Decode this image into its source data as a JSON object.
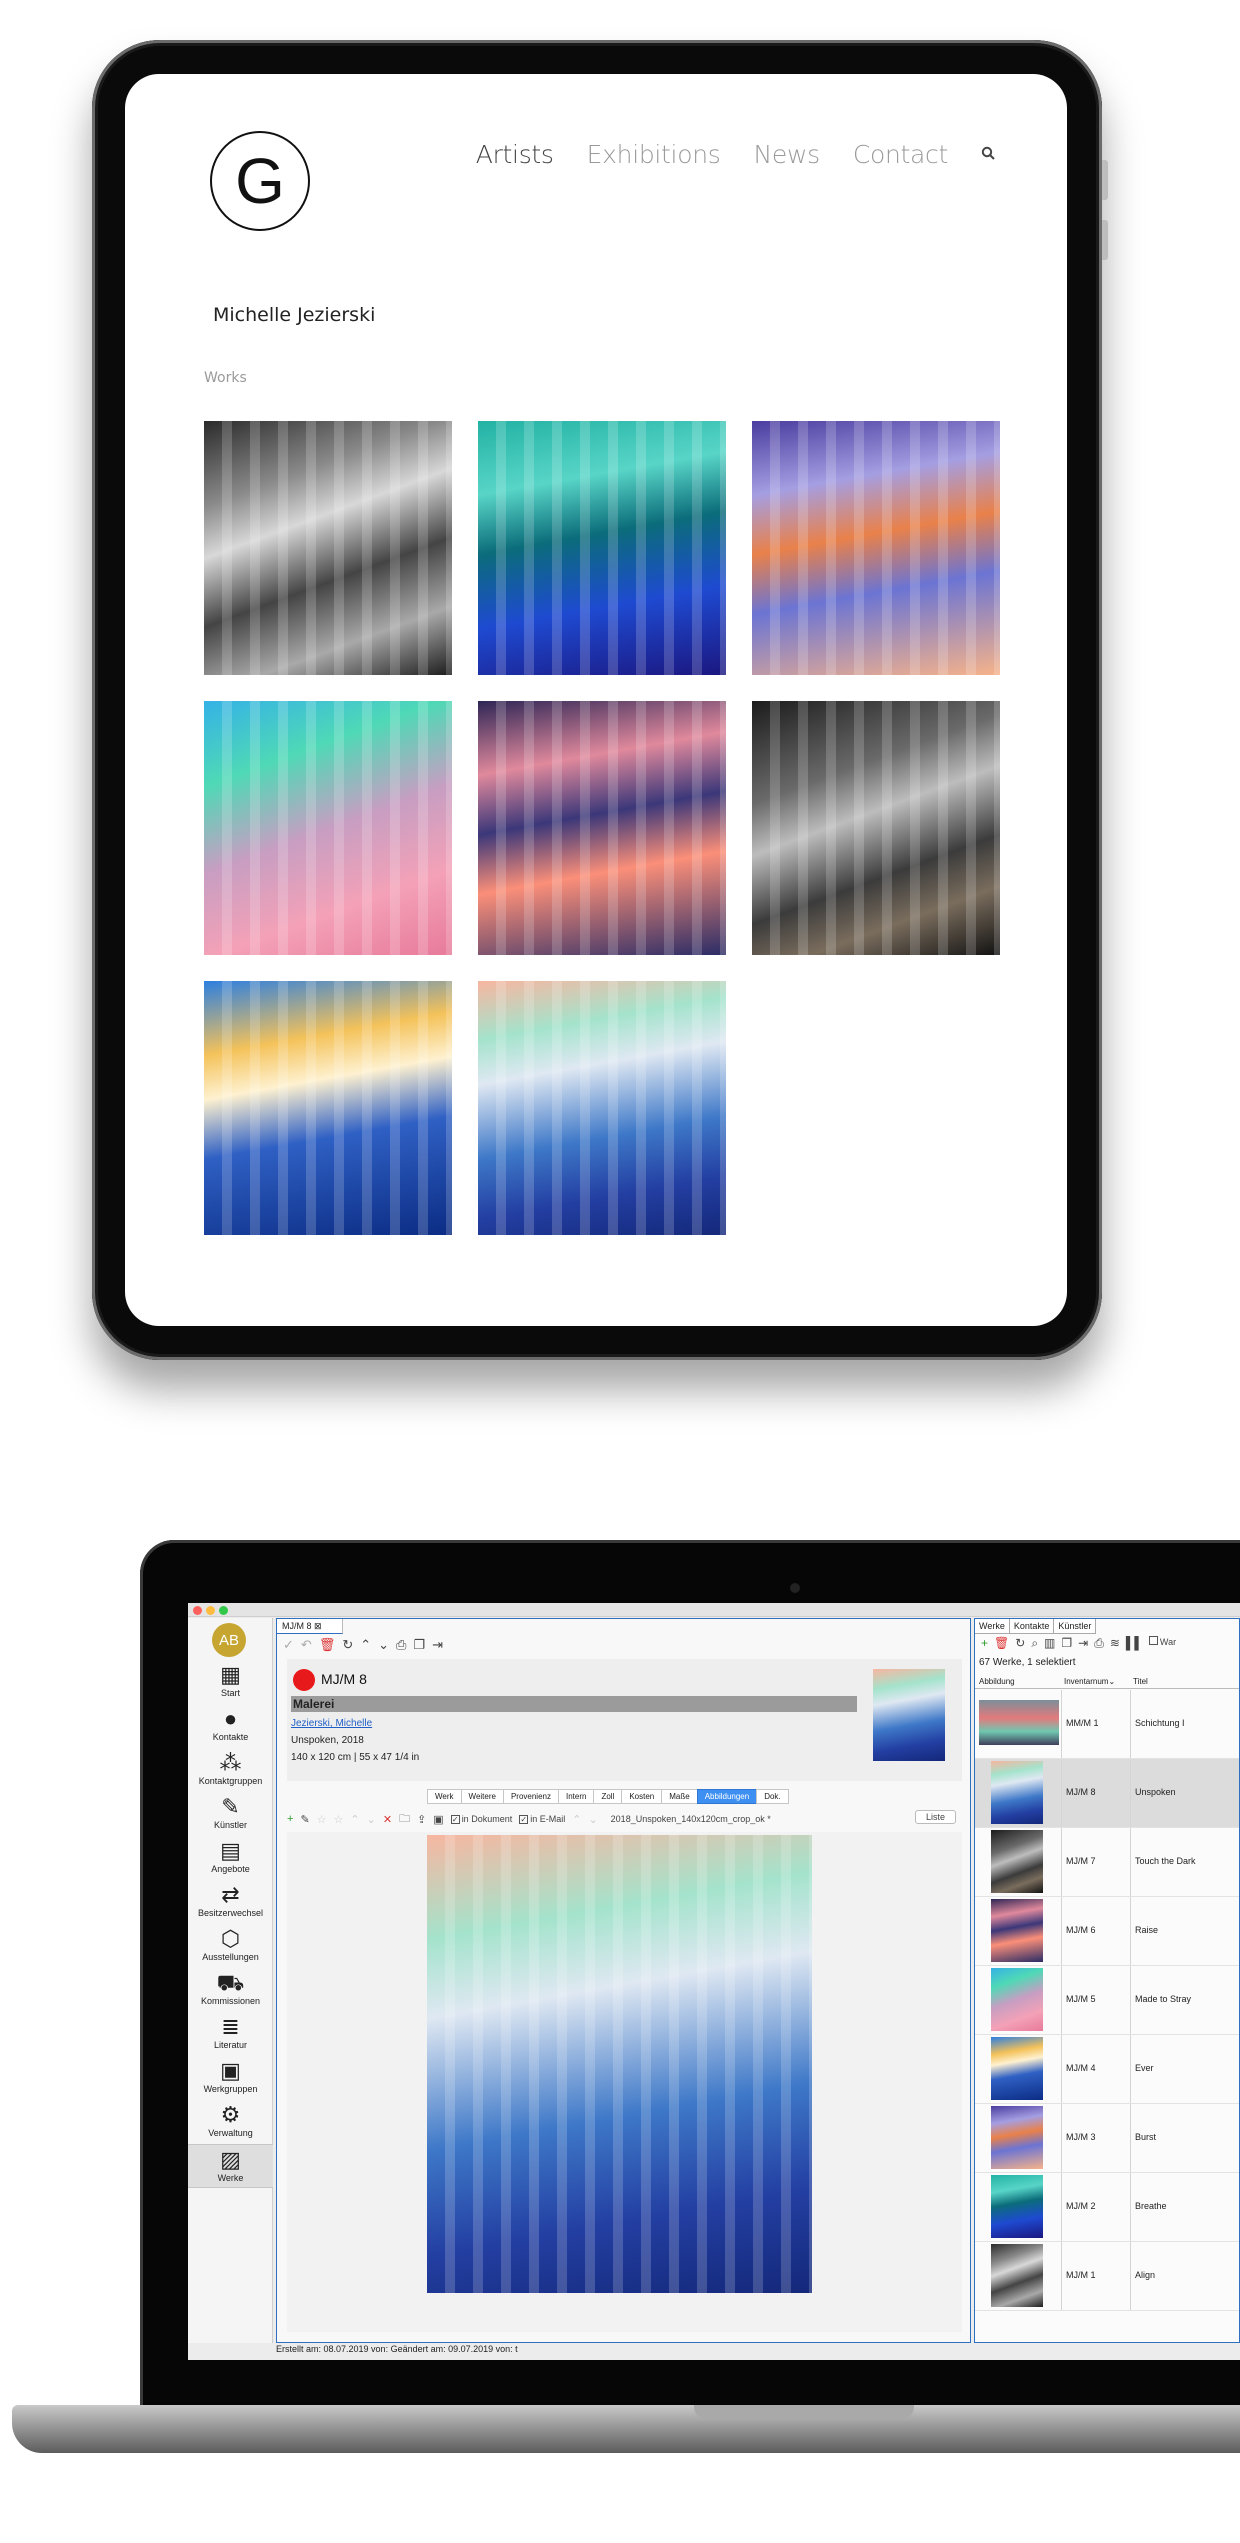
{
  "website": {
    "logo_letter": "G",
    "nav": [
      {
        "label": "Artists",
        "active": true
      },
      {
        "label": "Exhibitions",
        "active": false
      },
      {
        "label": "News",
        "active": false
      },
      {
        "label": "Contact",
        "active": false
      }
    ],
    "search_icon": "search-icon",
    "artist_name": "Michelle Jezierski",
    "section_label": "Works",
    "works_count_shown": 8
  },
  "app": {
    "sidebar": {
      "avatar_initials": "AB",
      "items": [
        {
          "label": "Start",
          "icon": "calendar-icon"
        },
        {
          "label": "Kontakte",
          "icon": "person-icon"
        },
        {
          "label": "Kontaktgruppen",
          "icon": "people-icon"
        },
        {
          "label": "Künstler",
          "icon": "brush-icon"
        },
        {
          "label": "Angebote",
          "icon": "document-icon"
        },
        {
          "label": "Besitzerwechsel",
          "icon": "handshake-icon"
        },
        {
          "label": "Ausstellungen",
          "icon": "box-icon"
        },
        {
          "label": "Kommissionen",
          "icon": "truck-icon"
        },
        {
          "label": "Literatur",
          "icon": "books-icon"
        },
        {
          "label": "Werkgruppen",
          "icon": "images-icon"
        },
        {
          "label": "Verwaltung",
          "icon": "gears-icon"
        },
        {
          "label": "Werke",
          "icon": "picture-icon",
          "active": true
        }
      ]
    },
    "doc_tab": "MJ/M 8",
    "record": {
      "id": "MJ/M 8",
      "status_color": "#e8191b",
      "category": "Malerei",
      "artist": "Jezierski, Michelle",
      "title_year": "Unspoken, 2018",
      "dimensions": "140 x 120 cm    |    55 x 47 1/4 in"
    },
    "detail_tabs": [
      "Werk",
      "Weitere",
      "Provenienz",
      "Intern",
      "Zoll",
      "Kosten",
      "Maße",
      "Abbildungen",
      "Dok."
    ],
    "active_detail_tab": "Abbildungen",
    "image_toolbar": {
      "in_dokument": "in Dokument",
      "in_email": "in E-Mail",
      "filename": "2018_Unspoken_140x120cm_crop_ok *",
      "liste": "Liste"
    },
    "status_bar": "Erstellt am: 08.07.2019 von:    Geändert am: 09.07.2019 von: t",
    "list": {
      "tabs": [
        "Werke",
        "Kontakte",
        "Künstler"
      ],
      "count_text": "67 Werke, 1 selektiert",
      "headers": [
        "Abbildung",
        "Inventarnum⌄",
        "Titel"
      ],
      "rows": [
        {
          "inv": "MM/M 1",
          "title": "Schichtung I",
          "selected": false
        },
        {
          "inv": "MJ/M 8",
          "title": "Unspoken",
          "selected": true
        },
        {
          "inv": "MJ/M 7",
          "title": "Touch the Dark",
          "selected": false
        },
        {
          "inv": "MJ/M 6",
          "title": "Raise",
          "selected": false
        },
        {
          "inv": "MJ/M 5",
          "title": "Made to Stray",
          "selected": false
        },
        {
          "inv": "MJ/M 4",
          "title": "Ever",
          "selected": false
        },
        {
          "inv": "MJ/M 3",
          "title": "Burst",
          "selected": false
        },
        {
          "inv": "MJ/M 2",
          "title": "Breathe",
          "selected": false
        },
        {
          "inv": "MJ/M 1",
          "title": "Align",
          "selected": false
        }
      ],
      "toolbar_trailing_label": "War"
    }
  },
  "colors": {
    "accent_blue": "#3d8ff2",
    "avatar": "#c6a531",
    "selection_row": "#dcdcdc"
  }
}
